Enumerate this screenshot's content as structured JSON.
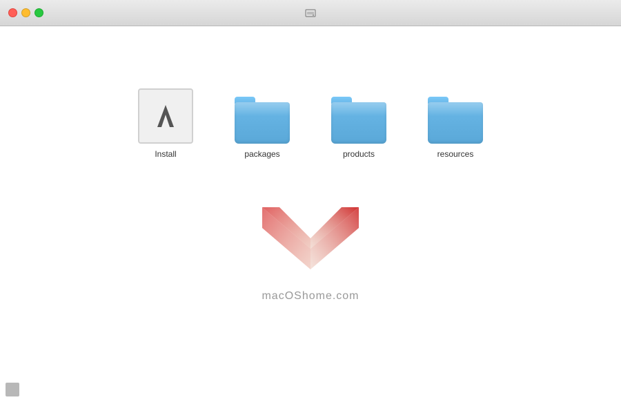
{
  "titlebar": {
    "title": "disk_icon"
  },
  "files": [
    {
      "id": "install",
      "label": "Install",
      "type": "adobe"
    },
    {
      "id": "packages",
      "label": "packages",
      "type": "folder"
    },
    {
      "id": "products",
      "label": "products",
      "type": "folder"
    },
    {
      "id": "resources",
      "label": "resources",
      "type": "folder"
    }
  ],
  "watermark": {
    "text": "macOShome.com"
  },
  "colors": {
    "close": "#ff5f57",
    "minimize": "#febc2e",
    "maximize": "#28c840",
    "folder_body": "#6ab8e8",
    "folder_tab": "#7ac8f8"
  }
}
